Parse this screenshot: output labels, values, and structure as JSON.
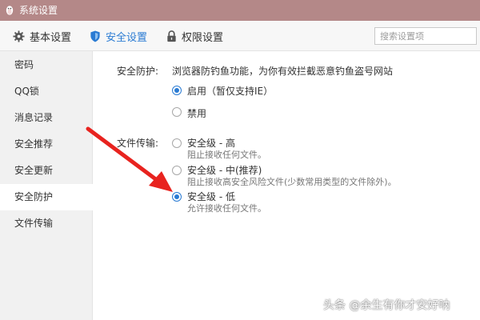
{
  "window": {
    "title": "系统设置"
  },
  "tabs": [
    {
      "label": "基本设置",
      "icon": "gear-icon"
    },
    {
      "label": "安全设置",
      "icon": "shield-icon",
      "active": true
    },
    {
      "label": "权限设置",
      "icon": "lock-icon"
    }
  ],
  "search": {
    "placeholder": "搜索设置项"
  },
  "sidebar": {
    "items": [
      {
        "label": "密码"
      },
      {
        "label": "QQ锁"
      },
      {
        "label": "消息记录"
      },
      {
        "label": "安全推荐"
      },
      {
        "label": "安全更新"
      },
      {
        "label": "安全防护",
        "active": true
      },
      {
        "label": "文件传输"
      }
    ]
  },
  "phishing": {
    "label": "安全防护:",
    "description": "浏览器防钓鱼功能，为你有效拦截恶意钓鱼盗号网站",
    "options": [
      {
        "label": "启用（暂仅支持IE）",
        "checked": true
      },
      {
        "label": "禁用",
        "checked": false
      }
    ]
  },
  "file_transfer": {
    "label": "文件传输:",
    "options": [
      {
        "label": "安全级 - 高",
        "sub": "阻止接收任何文件。",
        "checked": false
      },
      {
        "label": "安全级 - 中(推荐)",
        "sub": "阻止接收高安全风险文件(少数常用类型的文件除外)。",
        "checked": false
      },
      {
        "label": "安全级 - 低",
        "sub": "允许接收任何文件。",
        "checked": true
      }
    ]
  },
  "watermark": {
    "text": "头条 @余生有你才安好呐"
  },
  "colors": {
    "titlebar": "#b48888",
    "accent": "#2a7bd3",
    "arrow": "#e8231f"
  }
}
